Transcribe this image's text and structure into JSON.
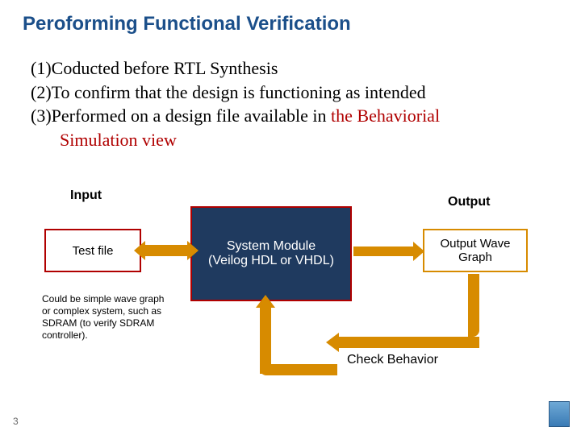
{
  "title": "Peroforming Functional Verification",
  "bullets": {
    "l1": "(1)Coducted before RTL Synthesis",
    "l2": "(2)To confirm that the design is functioning as intended",
    "l3a": "(3)Performed on a design file available in ",
    "l3b": "the Behaviorial",
    "l3c": "Simulation view"
  },
  "diagram": {
    "input_label": "Input",
    "output_label": "Output",
    "test_box": "Test file",
    "system_box": "System Module\n(Veilog HDL or VHDL)",
    "output_box": "Output Wave Graph",
    "caption": "Could be simple wave graph or complex system, such as SDRAM (to verify SDRAM controller).",
    "check_label": "Check Behavior"
  },
  "page_number": "3",
  "colors": {
    "title": "#1b4f8a",
    "accent_red": "#b00000",
    "accent_orange": "#d78b00",
    "sys_fill": "#1f3a5f"
  }
}
